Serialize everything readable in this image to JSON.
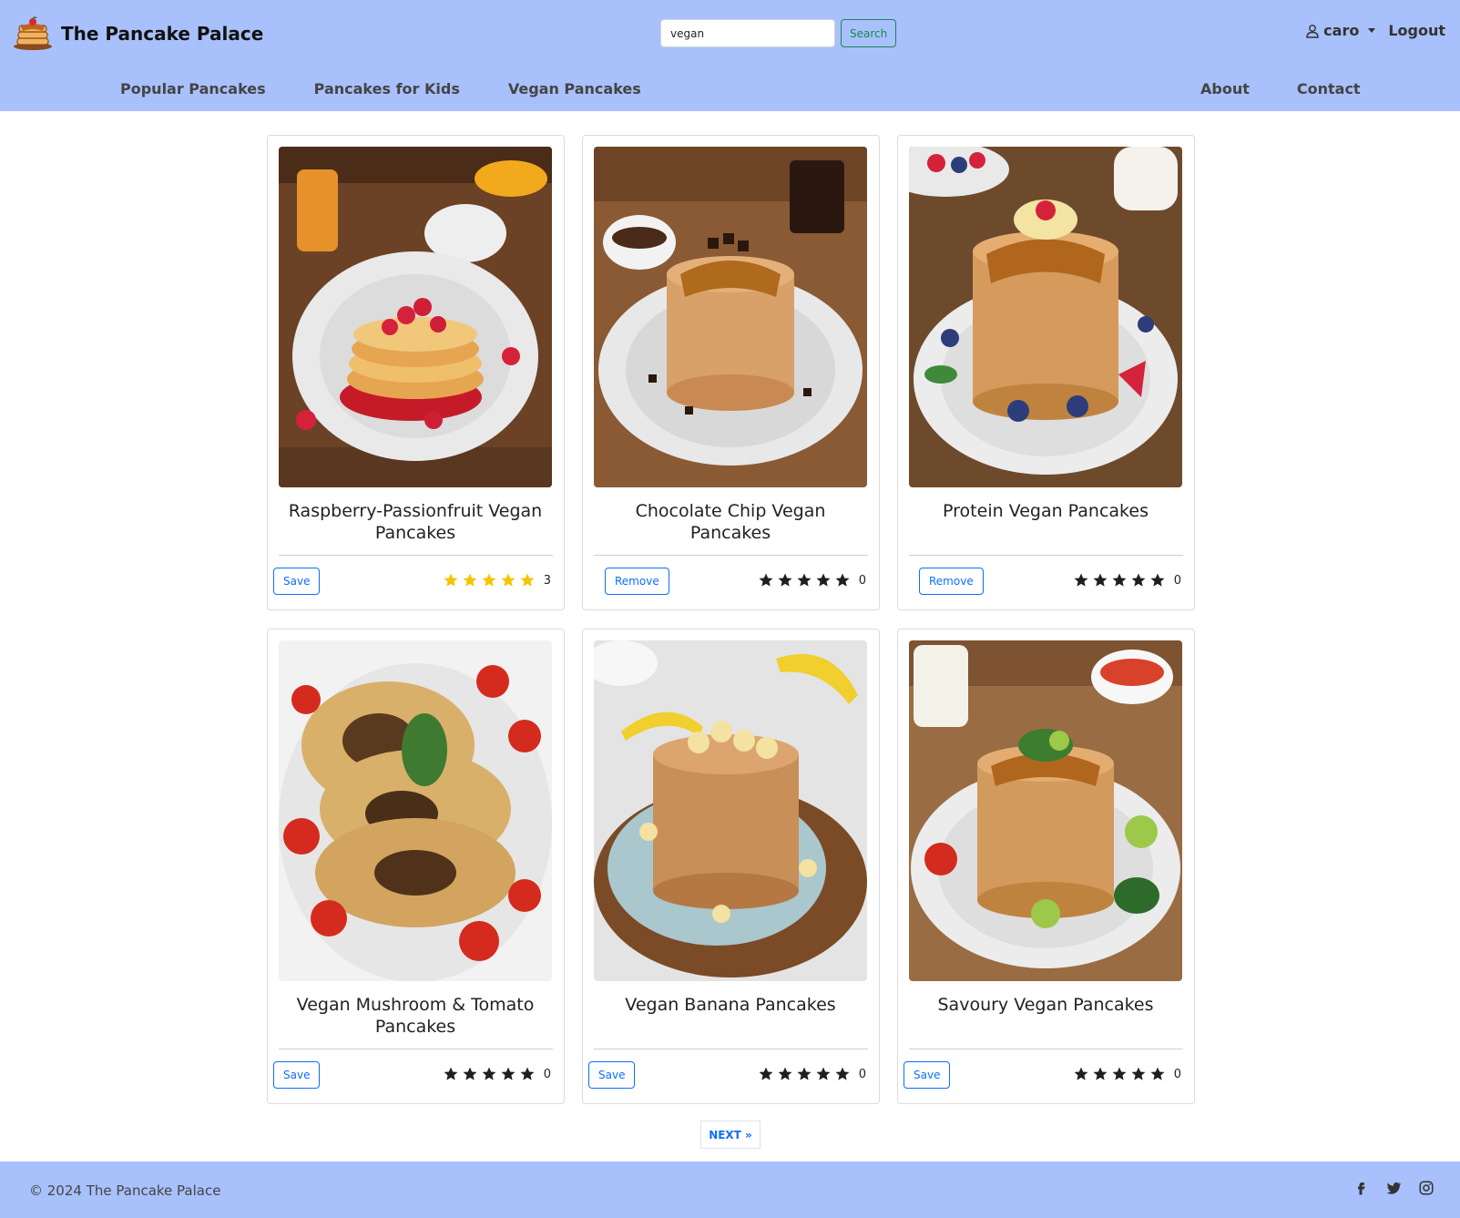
{
  "brand": {
    "name": "The Pancake Palace",
    "logo_icon": "pancake-stack-icon"
  },
  "search": {
    "value": "vegan",
    "button_label": "Search"
  },
  "user": {
    "name": "caro",
    "logout_label": "Logout"
  },
  "nav": {
    "left": [
      "Popular Pancakes",
      "Pancakes for Kids",
      "Vegan Pancakes"
    ],
    "right": [
      "About",
      "Contact"
    ]
  },
  "cards": [
    {
      "title": "Raspberry-Passionfruit Vegan Pancakes",
      "action": "Save",
      "rating": 5,
      "count": "3",
      "highlighted": true
    },
    {
      "title": "Chocolate Chip Vegan Pancakes",
      "action": "Remove",
      "rating": 0,
      "count": "0",
      "highlighted": false
    },
    {
      "title": "Protein Vegan Pancakes",
      "action": "Remove",
      "rating": 0,
      "count": "0",
      "highlighted": false
    },
    {
      "title": "Vegan Mushroom & Tomato Pancakes",
      "action": "Save",
      "rating": 0,
      "count": "0",
      "highlighted": false
    },
    {
      "title": "Vegan Banana Pancakes",
      "action": "Save",
      "rating": 0,
      "count": "0",
      "highlighted": false
    },
    {
      "title": "Savoury Vegan Pancakes",
      "action": "Save",
      "rating": 0,
      "count": "0",
      "highlighted": false
    }
  ],
  "pagination": {
    "next_label": "NEXT »"
  },
  "footer": {
    "copyright": "© 2024 The Pancake Palace",
    "socials": [
      "facebook-icon",
      "twitter-icon",
      "instagram-icon"
    ]
  },
  "colors": {
    "header_bg": "#a8c0fb",
    "accent": "#0d6efd",
    "search_green": "#198754",
    "star_yellow": "#f5c400",
    "star_dark": "#1f1f1f"
  }
}
